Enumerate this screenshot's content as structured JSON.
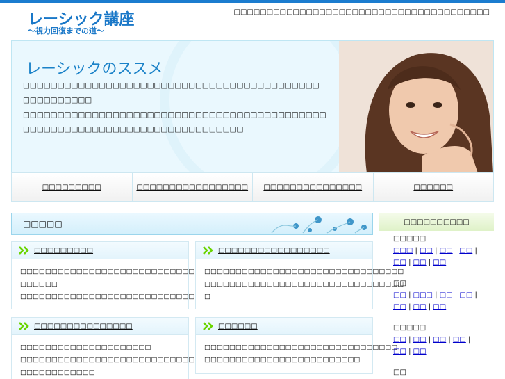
{
  "header": {
    "title": "レーシック講座",
    "subtitle": "〜視力回復までの道〜",
    "tagline": "□□□□□□□□□□□□□□□□□□□□□□□□□□□□□□□□□□□□□□□"
  },
  "hero": {
    "title": "レーシックのススメ",
    "line1": "□□□□□□□□□□□□□□□□□□□□□□□□□□□□□□□□□□□□□□□□□□□",
    "line2": "□□□□□□□□□□",
    "line3": "□□□□□□□□□□□□□□□□□□□□□□□□□□□□□□□□□□□□□□□□□□□□",
    "line4": "□□□□□□□□□□□□□□□□□□□□□□□□□□□□□□□□"
  },
  "nav": {
    "items": [
      {
        "label": "□□□□□□□□□"
      },
      {
        "label": "□□□□□□□□□□□□□□□□□"
      },
      {
        "label": "□□□□□□□□□□□□□□□"
      },
      {
        "label": "□□□□□□"
      }
    ]
  },
  "section": {
    "title": "□□□□□"
  },
  "cards": [
    {
      "title": "□□□□□□□□□",
      "line1": "□□□□□□□□□□□□□□□□□□□□□□□□□□□□□□□□",
      "line2": "□□□□□□",
      "line3": "□□□□□□□□□□□□□□□□□□□□□□□□□□□□□□□",
      "line4": ""
    },
    {
      "title": "□□□□□□□□□□□□□□□□□",
      "line1": "□□□□□□□□□□□□□□□□□□□□□□□□□□□□□□□□",
      "line2": "□□□□□□□□□□□□□□□□□□□□□□□□□□□□□□□□",
      "line3": "□",
      "line4": ""
    },
    {
      "title": "□□□□□□□□□□□□□□□",
      "line1": "□□□□□□□□□□□□□□□□□□□□□",
      "line2": "□□□□□□□□□□□□□□□□□□□□□□□□□□□□□□□□",
      "line3": "□□□□□□□□□□□□",
      "line4": ""
    },
    {
      "title": "□□□□□□",
      "line1": "□□□□□□□□□□□□□□□□□□□□□□□□□□□□□□□",
      "line2": "□□□□□□□□□□□□□□□□□□□□□□□□□",
      "line3": "",
      "line4": ""
    }
  ],
  "sidebar": {
    "title": "□□□□□□□□□□",
    "groups": [
      {
        "label": "□□□□□",
        "links": [
          "□□□",
          "□□",
          "□□",
          "□□",
          "□□",
          "□□",
          "□□"
        ]
      },
      {
        "label": "□□",
        "links": [
          "□□",
          "□□□",
          "□□",
          "□□",
          "□□",
          "□□",
          "□□"
        ]
      },
      {
        "label": "□□□□□",
        "links": [
          "□□",
          "□□",
          "□□",
          "□□",
          "□□",
          "□□"
        ]
      },
      {
        "label": "□□",
        "links": []
      }
    ]
  },
  "colors": {
    "accent": "#1b7ccf",
    "chevron": "#6ad400",
    "link": "#0000cc"
  }
}
